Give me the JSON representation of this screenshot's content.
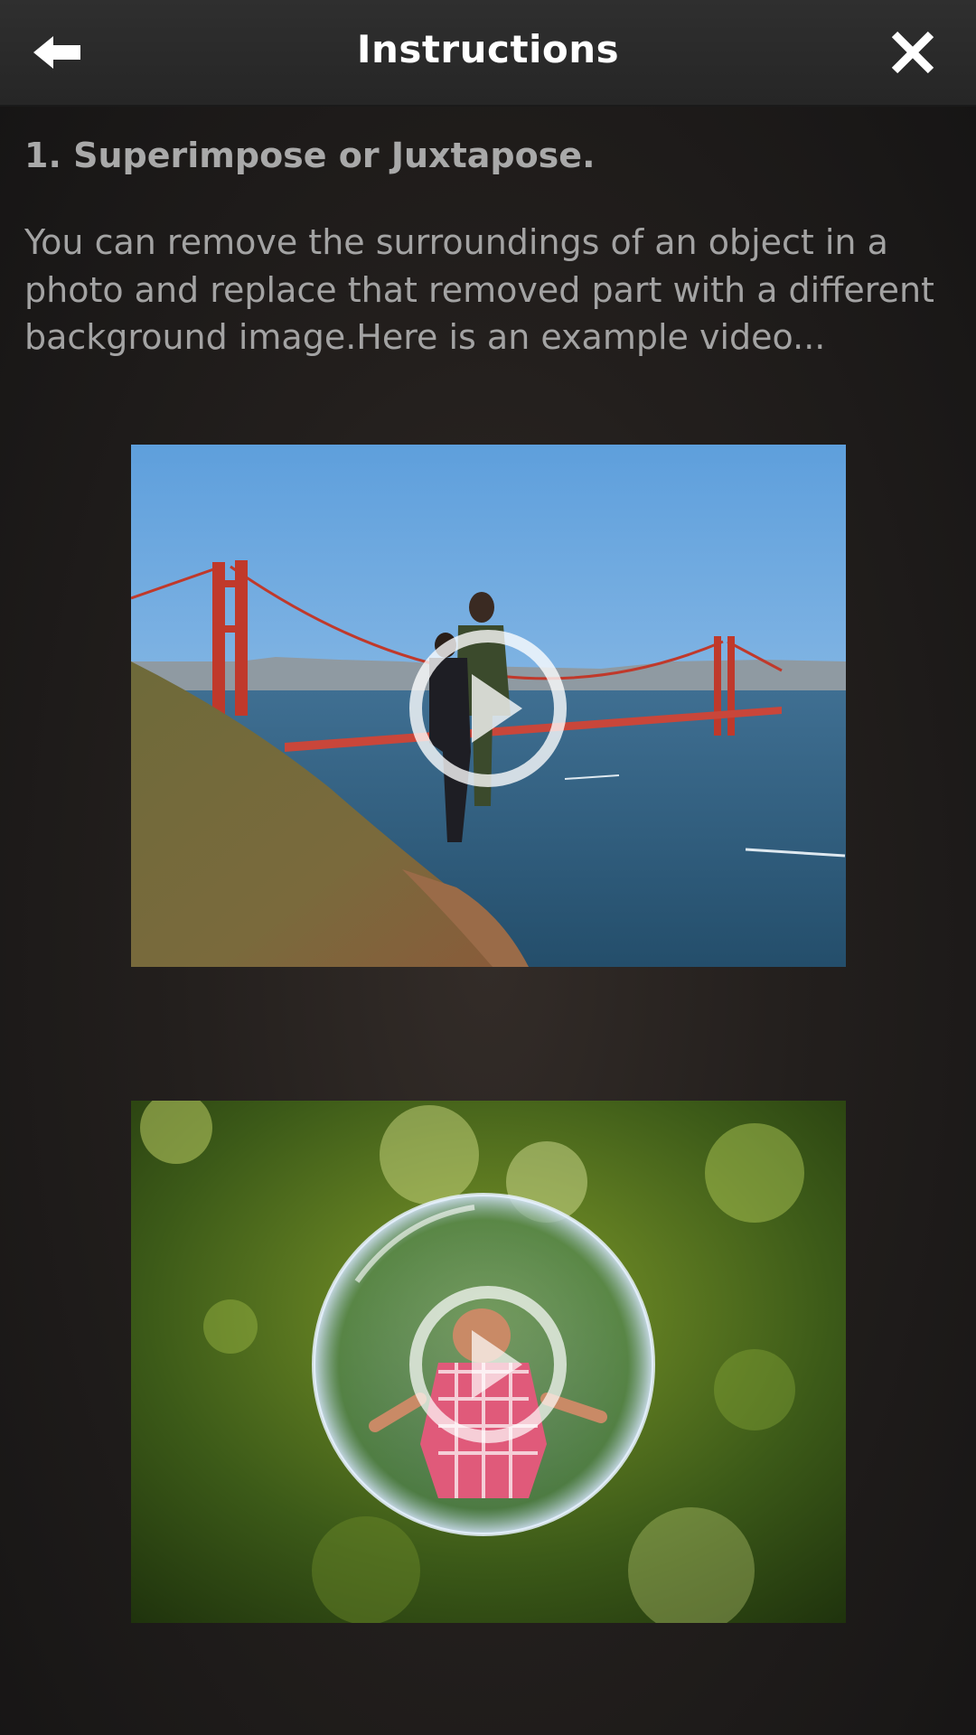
{
  "header": {
    "title": "Instructions",
    "back_icon": "back-arrow-icon",
    "close_icon": "close-icon"
  },
  "section": {
    "heading": "1. Superimpose or Juxtapose.",
    "body": "You can remove the surroundings of an object in a photo and replace that removed part with a different background image.Here is an example video..."
  },
  "videos": [
    {
      "thumbnail": "golden-gate-bridge-couple",
      "icon": "play-icon"
    },
    {
      "thumbnail": "child-in-soap-bubble",
      "icon": "play-icon"
    }
  ],
  "colors": {
    "header_bg": "#2b2b2b",
    "title_text": "#ffffff",
    "body_text": "#a3a3a3"
  }
}
